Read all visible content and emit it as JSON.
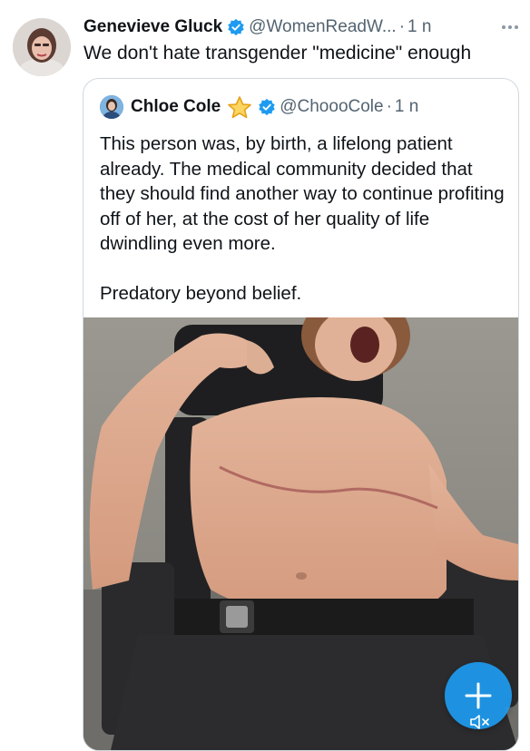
{
  "tweet": {
    "author_name": "Genevieve Gluck",
    "handle": "@WomenReadW...",
    "separator": "·",
    "time": "1 n",
    "text": "We don't hate transgender \"medicine\" enough",
    "avatar_icon": "user-avatar-photo",
    "verified_icon": "verified-badge-icon",
    "more_icon": "more-options-icon"
  },
  "quote": {
    "author_name": "Chloe Cole",
    "handle": "@ChoooCole",
    "separator": "·",
    "time": "1 n",
    "paragraph1": "This person was, by birth, a lifelong patient already. The medical community decided that they should find another way to continue profiting off of her, at the cost of her quality of life dwindling even more.",
    "paragraph2": "Predatory beyond belief.",
    "star_icon": "star-icon",
    "verified_icon": "verified-badge-icon"
  },
  "media": {
    "type": "video-still",
    "mute_icon": "speaker-muted-icon"
  },
  "compose_button": {
    "icon": "plus-icon"
  },
  "colors": {
    "text": "#0f1419",
    "secondary": "#536471",
    "accent": "#1d9bf0",
    "border": "#cfd9de"
  }
}
